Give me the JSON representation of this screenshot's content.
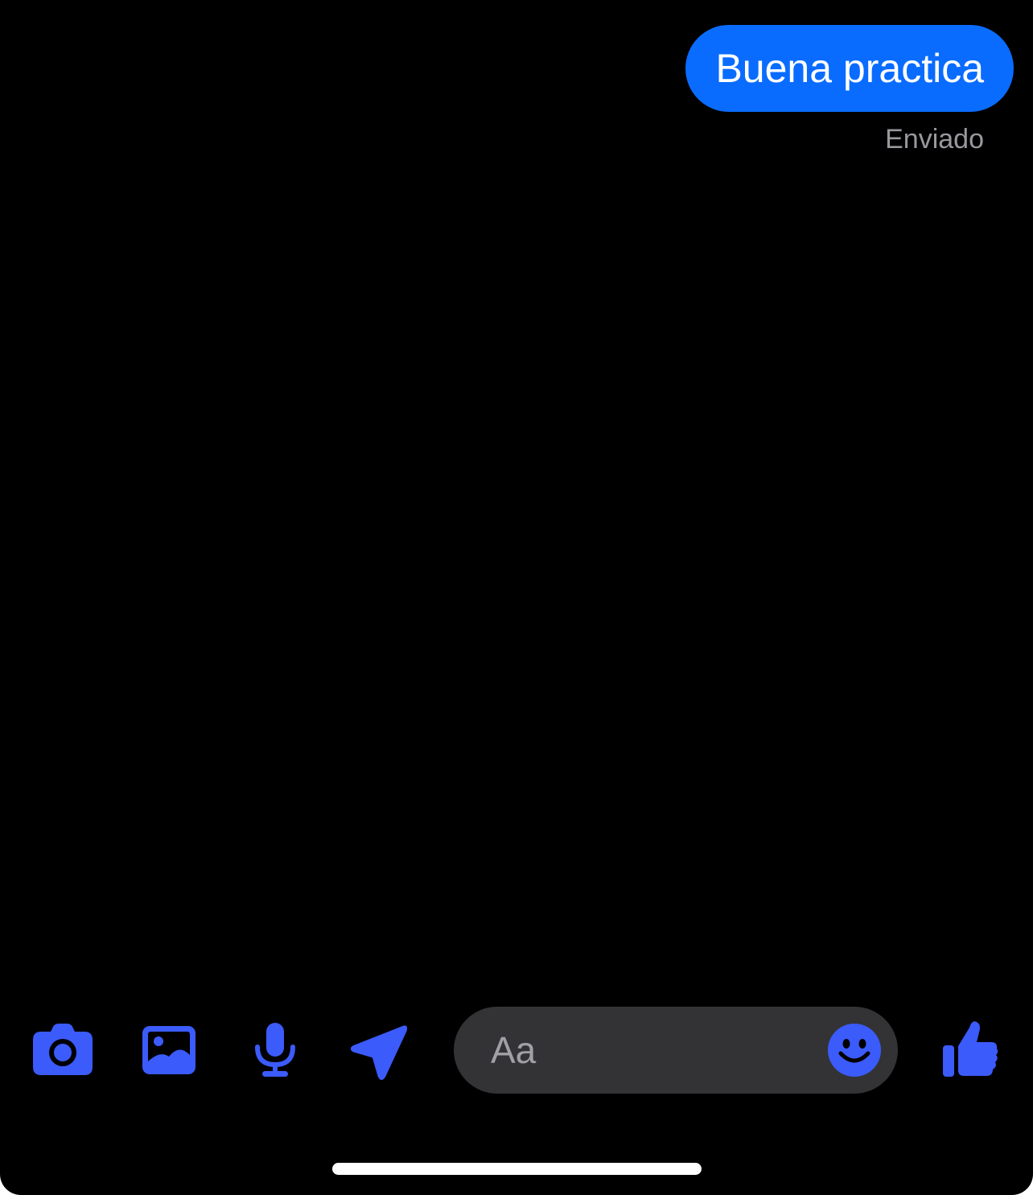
{
  "colors": {
    "background": "#000000",
    "bubble": "#0a6cff",
    "accent_icons": "#3b5bfb",
    "composer": "#333335",
    "status_text": "#98989e"
  },
  "messages": [
    {
      "text": "Buena practica",
      "status": "Enviado"
    }
  ],
  "composer": {
    "placeholder": "Aa"
  },
  "toolbar": {
    "icons": [
      "camera-icon",
      "photo-gallery-icon",
      "microphone-icon",
      "location-arrow-icon",
      "emoji-icon",
      "thumbs-up-icon"
    ]
  }
}
